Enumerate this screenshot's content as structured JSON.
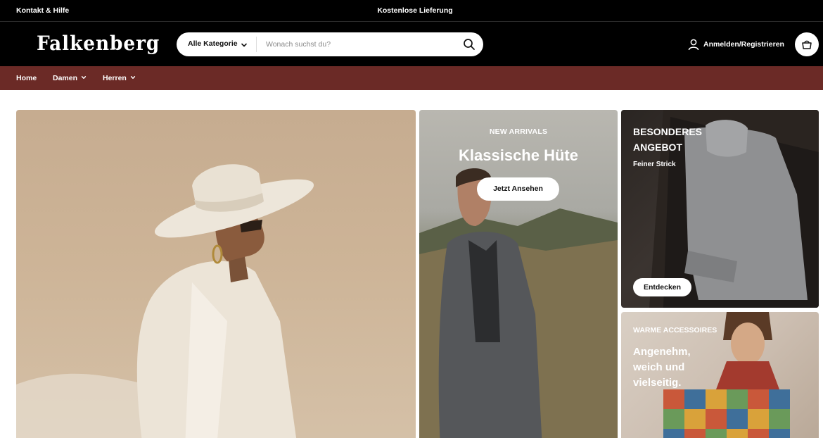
{
  "topbar": {
    "help_link": "Kontakt & Hilfe",
    "shipping_notice": "Kostenlose Lieferung"
  },
  "header": {
    "logo_text": "Falkenberg",
    "search": {
      "category_label": "Alle Kategorie",
      "placeholder": "Wonach suchst du?",
      "value": ""
    },
    "account_label": "Anmelden/Registrieren"
  },
  "nav": {
    "items": [
      {
        "label": "Home",
        "has_dropdown": false
      },
      {
        "label": "Damen",
        "has_dropdown": true
      },
      {
        "label": "Herren",
        "has_dropdown": true
      }
    ]
  },
  "hero": {
    "main_tile": {},
    "hats_tile": {
      "eyebrow": "NEW ARRIVALS",
      "headline": "Klassische Hüte",
      "button": "Jetzt Ansehen"
    },
    "offer_tile": {
      "eyebrow": "BESONDERES ANGEBOT",
      "subtitle": "Feiner Strick",
      "button": "Entdecken"
    },
    "accessories_tile": {
      "eyebrow": "WARME ACCESSOIRES",
      "headline": "Angenehm, weich und vielseitig."
    }
  },
  "colors": {
    "topbar": "#000000",
    "nav_background": "#6b2a26",
    "button_background": "#ffffff"
  },
  "icons": {
    "search": "search-icon",
    "account": "user-icon",
    "cart": "shopping-bag-icon",
    "dropdown": "chevron-down-icon"
  }
}
